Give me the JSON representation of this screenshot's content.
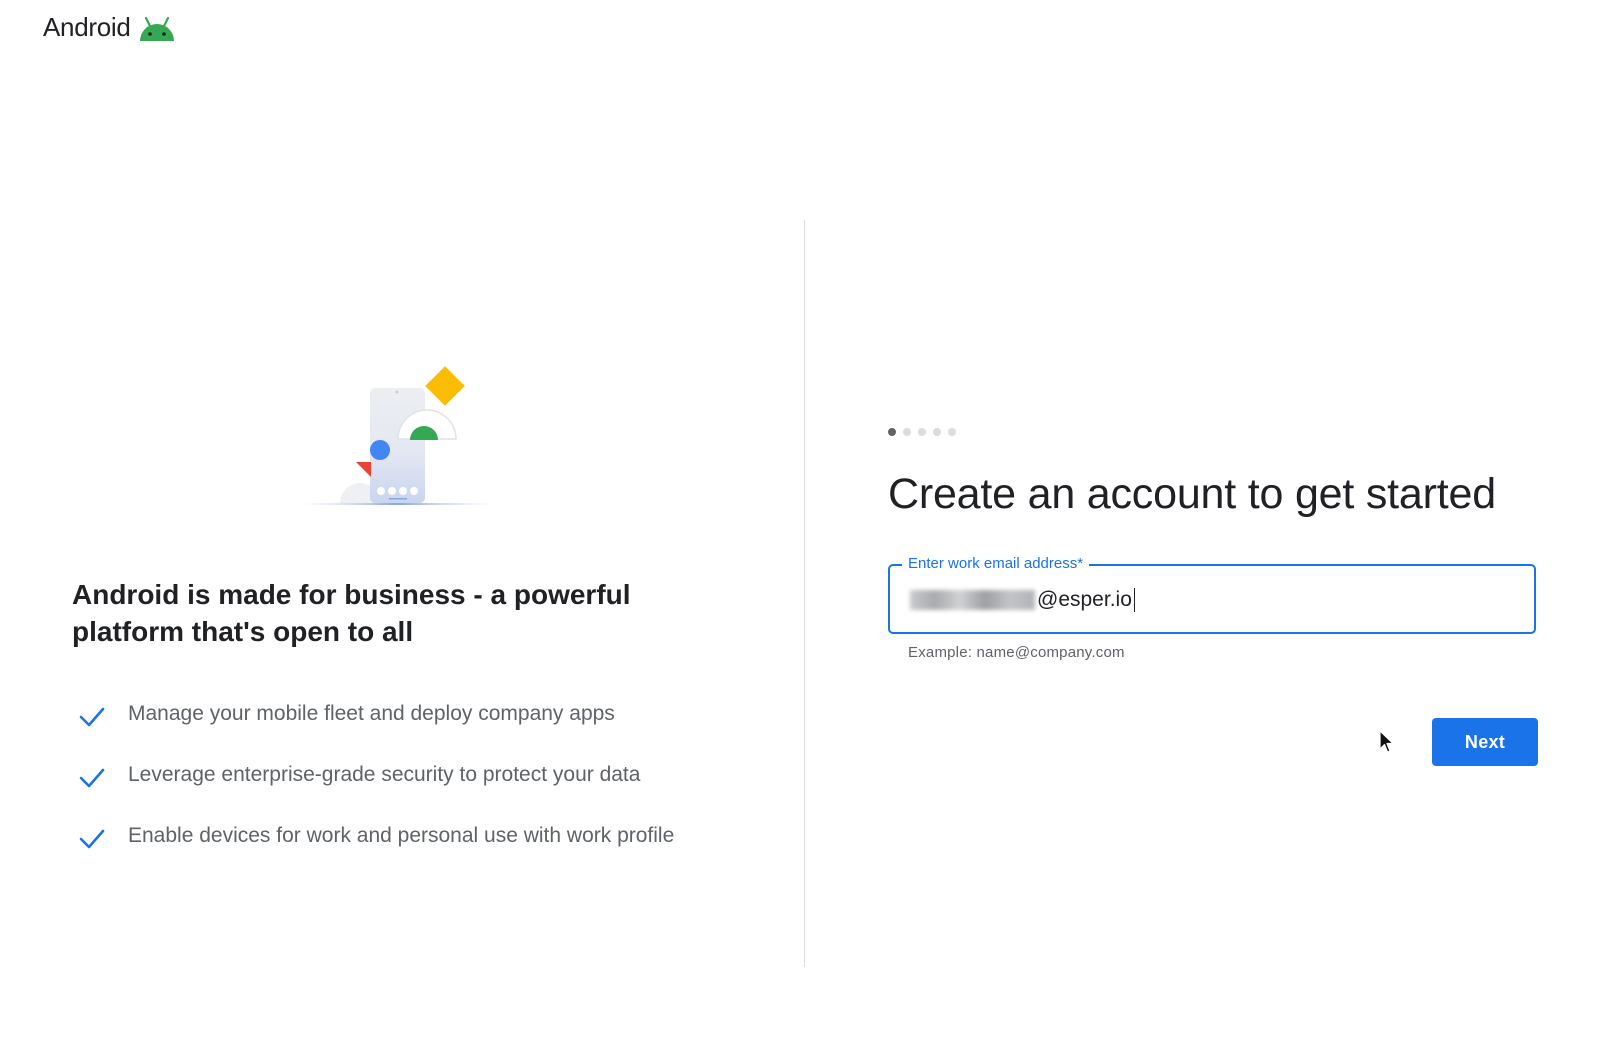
{
  "header": {
    "brand_name": "Android",
    "brand_icon": "android-robot-icon"
  },
  "left_pane": {
    "heading": "Android is made for business - a powerful platform that's open to all",
    "features": [
      {
        "icon": "check-icon",
        "text": "Manage your mobile fleet and deploy company apps"
      },
      {
        "icon": "check-icon",
        "text": "Leverage enterprise-grade security to protect your data"
      },
      {
        "icon": "check-icon",
        "text": "Enable devices for work and personal use with work profile"
      }
    ]
  },
  "right_pane": {
    "stepper": {
      "total_steps": 5,
      "current_step": 1
    },
    "heading": "Create an account to get started",
    "email_field": {
      "label": "Enter work email address*",
      "value_visible_suffix": "@esper.io",
      "hint": "Example: name@company.com"
    },
    "next_button_label": "Next"
  },
  "colors": {
    "accent": "#1a73e8",
    "android_green": "#34a853",
    "text_primary": "#202124",
    "text_secondary": "#5f6368",
    "divider": "#dadce0"
  }
}
